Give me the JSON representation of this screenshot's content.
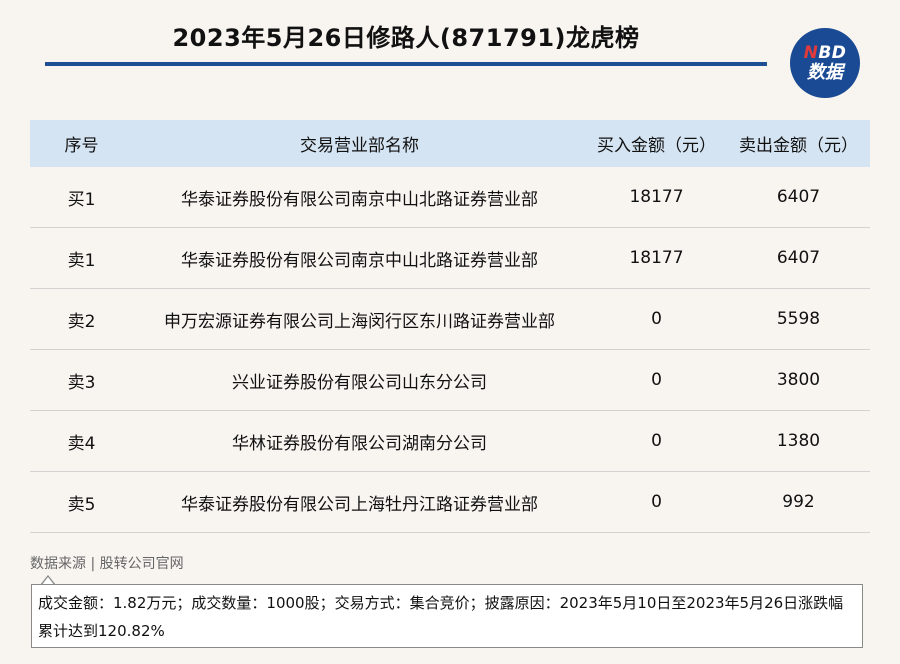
{
  "title": "2023年5月26日修路人(871791)龙虎榜",
  "logo": {
    "line1_n": "N",
    "line1_rest": "BD",
    "line2": "数据"
  },
  "colors": {
    "accent": "#1e4f94",
    "header_bg": "#d5e4f2",
    "logo_red": "#e23a3a"
  },
  "table": {
    "headers": [
      "序号",
      "交易营业部名称",
      "买入金额（元）",
      "卖出金额（元）"
    ],
    "rows": [
      {
        "rank": "买1",
        "name": "华泰证券股份有限公司南京中山北路证券营业部",
        "buy": "18177",
        "sell": "6407"
      },
      {
        "rank": "卖1",
        "name": "华泰证券股份有限公司南京中山北路证券营业部",
        "buy": "18177",
        "sell": "6407"
      },
      {
        "rank": "卖2",
        "name": "申万宏源证券有限公司上海闵行区东川路证券营业部",
        "buy": "0",
        "sell": "5598"
      },
      {
        "rank": "卖3",
        "name": "兴业证券股份有限公司山东分公司",
        "buy": "0",
        "sell": "3800"
      },
      {
        "rank": "卖4",
        "name": "华林证券股份有限公司湖南分公司",
        "buy": "0",
        "sell": "1380"
      },
      {
        "rank": "卖5",
        "name": "华泰证券股份有限公司上海牡丹江路证券营业部",
        "buy": "0",
        "sell": "992"
      }
    ]
  },
  "source": "数据来源 | 股转公司官网",
  "note": "成交金额：1.82万元；成交数量：1000股；交易方式：集合竞价；披露原因：2023年5月10日至2023年5月26日涨跌幅累计达到120.82%"
}
